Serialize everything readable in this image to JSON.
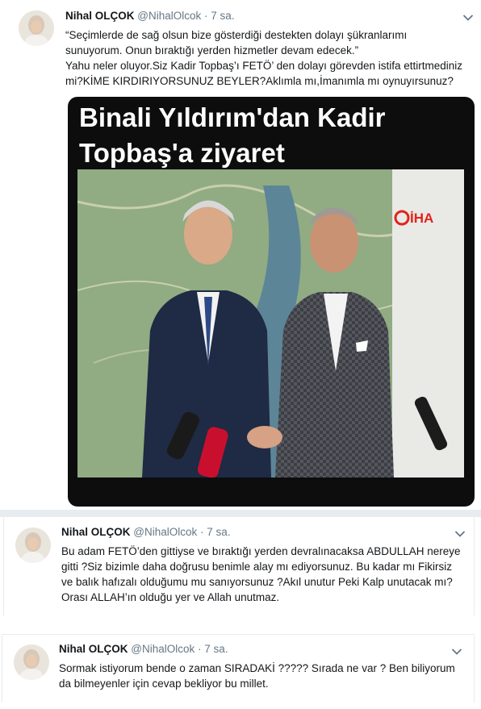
{
  "tweets": [
    {
      "name": "Nihal OLÇOK",
      "handle": "@NihalOlcok",
      "dot": "·",
      "time": "7 sa.",
      "text": "“Seçimlerde de sağ olsun bize gösterdiği destekten dolayı şükranlarımı\nsunuyorum. Onun bıraktığı yerden hizmetler devam edecek.”\nYahu neler oluyor.Siz Kadir Topbaş’ı FETÖ’ den dolayı görevden istifa ettirtmediniz\nmi?KİME KIRDIRIYORSUNUZ BEYLER?Aklımla mı,İmanımla mı oynuyırsunuz?",
      "media": {
        "title": "Binali Yıldırım'dan Kadir\nTopbaş'a ziyaret",
        "watermark": "İHA"
      }
    },
    {
      "name": "Nihal OLÇOK",
      "handle": "@NihalOlcok",
      "dot": "·",
      "time": "7 sa.",
      "text": "Bu adam FETÖ’den gittiyse ve bıraktığı yerden devralınacaksa ABDULLAH nereye\ngitti ?Siz bizimle daha doğrusu benimle alay mı ediyorsunuz. Bu kadar mı Fikirsiz\nve balık hafızalı olduğumu mu sanıyorsunuz ?Akıl unutur Peki Kalp unutacak mı?\nOrası ALLAH’ın olduğu yer ve Allah unutmaz."
    },
    {
      "name": "Nihal OLÇOK",
      "handle": "@NihalOlcok",
      "dot": "·",
      "time": "7 sa.",
      "text": "Sormak istiyorum bende o zaman SIRADAKİ ????? Sırada ne var ? Ben biliyorum\nda bilmeyenler için cevap bekliyor bu millet."
    }
  ],
  "icons": {
    "avatar": "profile-photo",
    "chevron": "chevron-down-icon"
  },
  "colors": {
    "name": "#14171a",
    "meta": "#657786",
    "divider": "#e6ecf0",
    "media_bg": "#0d0d0d",
    "watermark": "#e2231a"
  }
}
